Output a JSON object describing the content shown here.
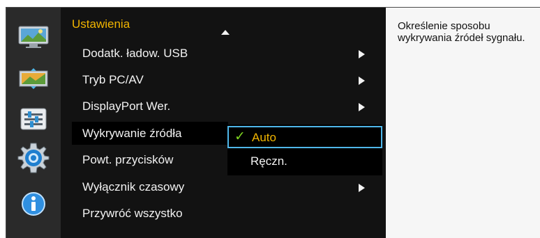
{
  "menu": {
    "title": "Ustawienia",
    "items": [
      {
        "label": "Dodatk. ładow. USB",
        "has_submenu": true
      },
      {
        "label": "Tryb PC/AV",
        "has_submenu": true
      },
      {
        "label": "DisplayPort Wer.",
        "has_submenu": true
      },
      {
        "label": "Wykrywanie źródła",
        "has_submenu": false,
        "selected": true
      },
      {
        "label": "Powt. przycisków",
        "has_submenu": false
      },
      {
        "label": "Wyłącznik czasowy",
        "has_submenu": true
      },
      {
        "label": "Przywróć wszystko",
        "has_submenu": false
      }
    ]
  },
  "submenu": {
    "options": [
      {
        "label": "Auto",
        "checked": true,
        "focused": true
      },
      {
        "label": "Ręczn.",
        "checked": false,
        "focused": false
      }
    ],
    "check_mark": "✓"
  },
  "description": "Określenie sposobu wykrywania źródeł sygnału.",
  "sidebar": {
    "icons": [
      "picture-icon",
      "onscreen-display-icon",
      "system-icon",
      "setup-gear-icon",
      "information-icon"
    ]
  },
  "colors": {
    "title": "#f0b400",
    "focus_border": "#4fb7ea",
    "check": "#7ed321"
  }
}
